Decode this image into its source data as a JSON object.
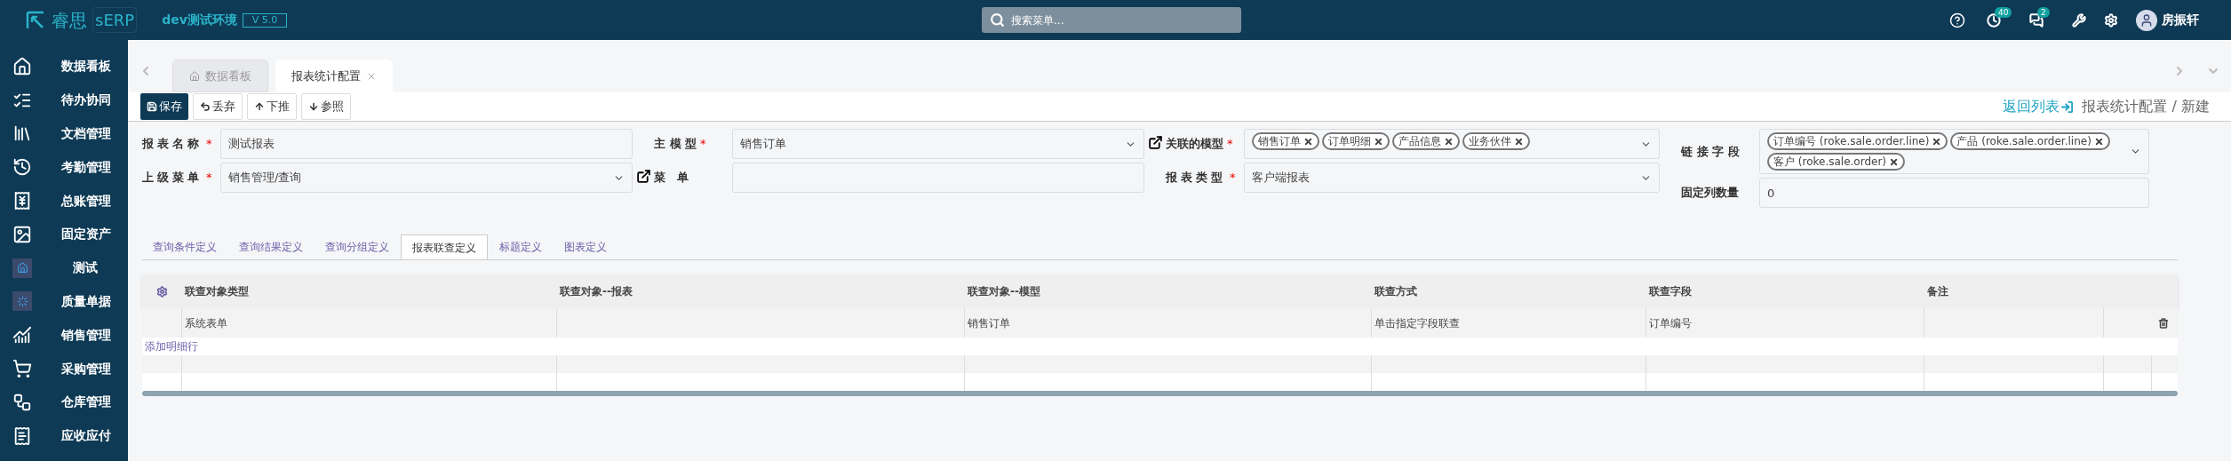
{
  "header": {
    "logo_text": "睿思",
    "logo_suffix": "sERP",
    "env": "dev测试环境",
    "version": "V 5.0",
    "search": {
      "placeholder": "搜索菜单..."
    },
    "activity_badge": "40",
    "message_badge": "2",
    "user": "房振轩"
  },
  "sidebar": {
    "items": [
      {
        "label": "数据看板"
      },
      {
        "label": "待办协同"
      },
      {
        "label": "文档管理"
      },
      {
        "label": "考勤管理"
      },
      {
        "label": "总账管理"
      },
      {
        "label": "固定资产"
      },
      {
        "label": "测试"
      },
      {
        "label": "质量单据"
      },
      {
        "label": "销售管理"
      },
      {
        "label": "采购管理"
      },
      {
        "label": "仓库管理"
      },
      {
        "label": "应收应付"
      }
    ]
  },
  "tabs": [
    {
      "label": "数据看板",
      "selected": false
    },
    {
      "label": "报表统计配置",
      "selected": true
    }
  ],
  "toolbar": {
    "buttons": [
      {
        "label": "保存",
        "kind": "save"
      },
      {
        "label": "丢弃",
        "kind": "undo"
      },
      {
        "label": "下推",
        "kind": "up"
      },
      {
        "label": "参照",
        "kind": "down"
      }
    ],
    "breadcrumb": {
      "back": "返回列表",
      "path": "报表统计配置 / 新建"
    }
  },
  "form": {
    "columns": [
      [
        {
          "label": "报表名称",
          "required_mark": "*",
          "kind": "input",
          "value": "测试报表",
          "link": false
        },
        {
          "label": "上级菜单",
          "required_mark": "*",
          "kind": "select",
          "value": "销售管理/查询",
          "link": true
        }
      ],
      [
        {
          "label": "主 模 型",
          "required_mark": "*",
          "kind": "select",
          "value": "销售订单",
          "link": true
        },
        {
          "label": "菜 单",
          "kind": "input",
          "link": false
        }
      ],
      [
        {
          "label": "关联的模型",
          "required_mark": "*",
          "kind": "tags",
          "tags": [
            "销售订单",
            "订单明细",
            "产品信息",
            "业务伙伴"
          ],
          "link": false
        },
        {
          "label": "报表类型",
          "required_mark": "*",
          "kind": "select",
          "value": "客户端报表",
          "link": false
        }
      ],
      [
        {
          "label": "链 接 字 段",
          "kind": "tags",
          "tags": [
            "订单编号 (roke.sale.order.line)",
            "产品 (roke.sale.order.line)",
            "客户 (roke.sale.order)"
          ],
          "link": false
        },
        {
          "label": "固定列数量",
          "kind": "input",
          "value": "0",
          "link": false
        }
      ]
    ]
  },
  "subtabs": [
    {
      "label": "查询条件定义",
      "selected": false
    },
    {
      "label": "查询结果定义",
      "selected": false
    },
    {
      "label": "查询分组定义",
      "selected": false
    },
    {
      "label": "报表联查定义",
      "selected": true
    },
    {
      "label": "标题定义",
      "selected": false
    },
    {
      "label": "图表定义",
      "selected": false
    }
  ],
  "table": {
    "columns": [
      "联查对象类型",
      "联查对象--报表",
      "联查对象--模型",
      "联查方式",
      "联查字段",
      "备注"
    ],
    "rows": [
      [
        "系统表单",
        "",
        "销售订单",
        "单击指定字段联查",
        "订单编号",
        ""
      ]
    ],
    "add_row": "添加明细行"
  }
}
